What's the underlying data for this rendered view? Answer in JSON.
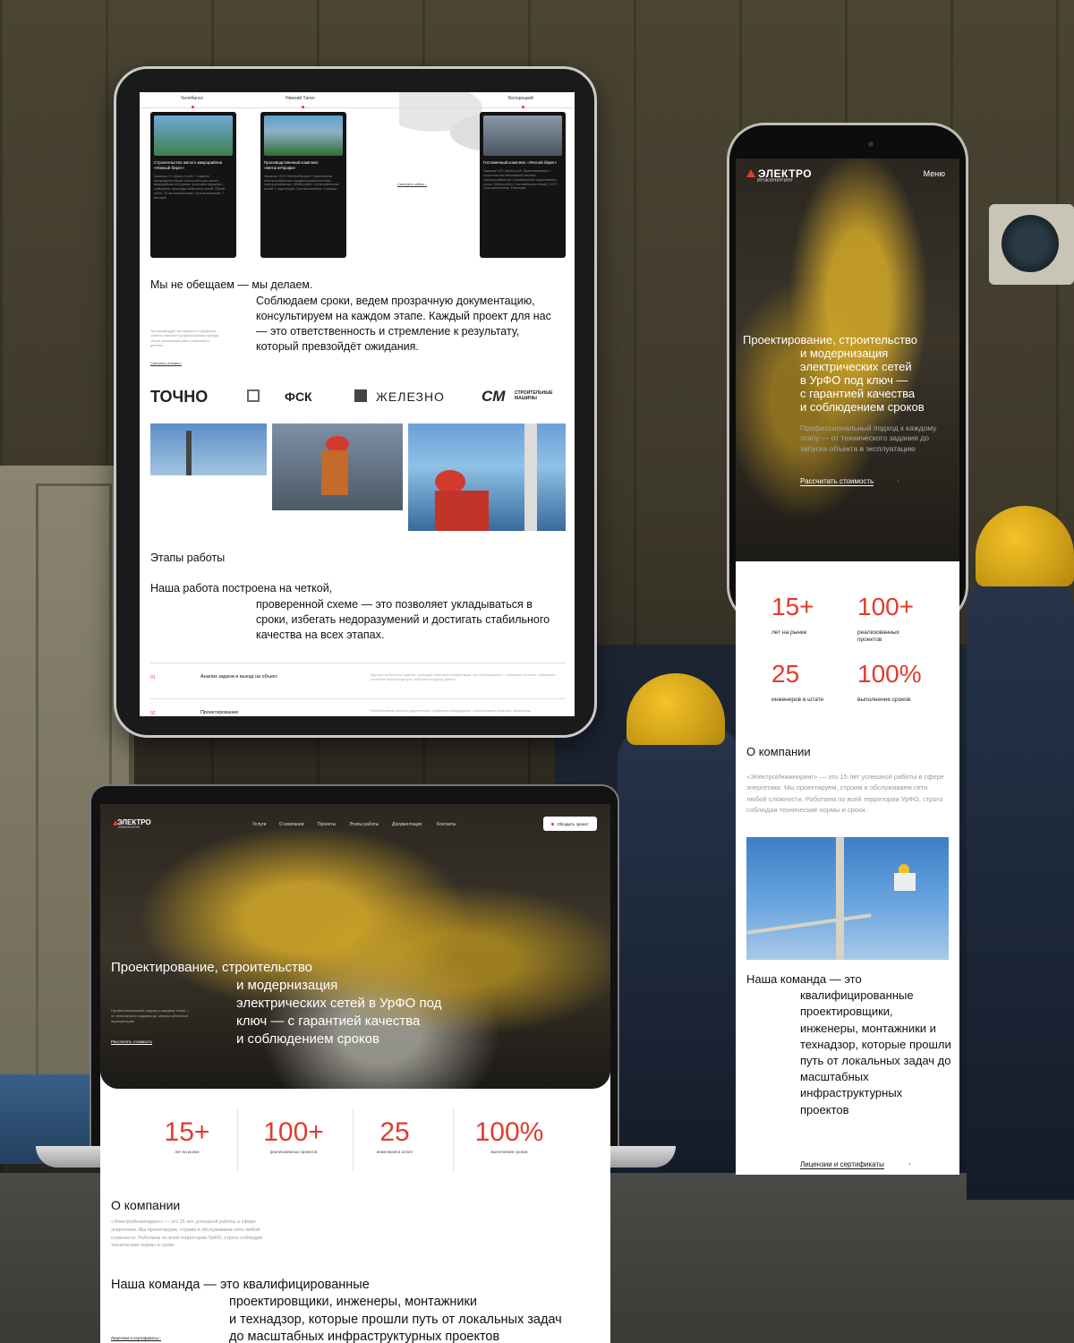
{
  "tablet": {
    "cities": [
      "Челябинск",
      "Нижний Тагил",
      "Белорецкий"
    ],
    "cards": [
      {
        "title": "Строительство жилого микрорайона «Южный берег»",
        "text": "Заказчик: ГК «Диал-Строй». Создание распределительной электросети для жилого микрорайона на 8 домов, установка наружного освещения, прокладка кабельных линий. Объём работ: 10 км электролиний. Срок выполнения: 7 месяцев"
      },
      {
        "title": "Производственный комплекс «МеталлПрофи»",
        "text": "Заказчик: ООО «МеталлПрофи». Комплексное электроснабжение с модернизацией системы электроснабжения. Объём работ: 4,8 км кабельных линий, 1 подстанция. Срок выполнения: 4 месяца"
      },
      {
        "title": "Гостиничный комплекс «Лесной берег»",
        "text": "Заказчик: ИП Сазонов А.В. Проектирование и строительство автономной системы электроснабжения с возможностью подключения к сетям. Объём работ: 3 км кабельных линий, 1 КТП. Срок выполнения: 5 месяцев"
      }
    ],
    "see_cases": "Смотреть кейсы ›",
    "tagline_head": "Мы не обещаем — мы делаем.",
    "tagline_body": "Соблюдаем сроки, ведем прозрачную документацию, консультируем на каждом этапе. Каждый проект для нас — это ответственность и стремление к результату, который превзойдёт ожидания.",
    "tagline_small": "Нас рекомендуют как надежного подрядчика: клиенты отмечают профессионализм команды, четкую организацию работ и внимание к деталям.",
    "reviews_link": "Смотреть отзывы ›",
    "logos": [
      "ТОЧНО",
      "ФСК",
      "ЖЕЛЕЗНО",
      "СМ",
      "СТРОИТЕЛЬНЫЕ МАШИНЫ"
    ],
    "steps_title": "Этапы работы",
    "steps_head": "Наша работа построена на четкой,",
    "steps_body": "проверенной схеме — это позволяет укладываться в сроки, избегать недоразумений и достигать стабильного качества на всех этапах.",
    "steps": [
      {
        "num": "01",
        "name": "Анализ задачи и выезд на объект",
        "desc": "Изучаем техническое задание, проводим первичную консультацию, при необходимости — выезжаем на место. Оцениваем состояние инфраструктуры, собираем исходные данные."
      },
      {
        "num": "02",
        "name": "Проектирование",
        "desc": "Разрабатываем рабочую документацию, подбираем оборудование, согласовываем решения с заказчиком."
      }
    ]
  },
  "phone": {
    "logo": "ЭЛЕКТРО",
    "logo_sub": "ИНЖИНИРИНГ",
    "menu": "Меню",
    "hero_first": "Проектирование, строительство",
    "hero_rest": [
      "и модернизация",
      "электрических сетей",
      "в УрФО под ключ —",
      "с гарантией качества",
      "и соблюдением сроков"
    ],
    "hero_sub": "Профессиональный подход к каждому этапу — от технического задания до запуска объекта в эксплуатацию",
    "cta": "Рассчитать стоимость",
    "stats": [
      {
        "num": "15+",
        "label": "лет на рынке"
      },
      {
        "num": "100+",
        "label": "реализованных проектов"
      },
      {
        "num": "25",
        "label": "инженеров в штате"
      },
      {
        "num": "100%",
        "label": "выполнение сроков"
      }
    ],
    "about_title": "О компании",
    "about_text": "«ЭлектроИнжиниринг» — это 15 лет успешной работы в сфере энергетики. Мы проектируем, строим и обслуживаем сети любой сложности. Работаем по всей территории УрФО, строго соблюдая технические нормы и сроки.",
    "team_first": "Наша команда — это",
    "team_rest": "квалифицированные проектировщики, инженеры, монтажники и технадзор, которые прошли путь от локальных задач до масштабных инфраструктурных проектов",
    "licenses": "Лицензии и сертификаты"
  },
  "laptop": {
    "logo": "ЭЛЕКТРО",
    "logo_sub": "ИНЖИНИРИНГ",
    "nav": [
      "Услуги",
      "О компании",
      "Проекты",
      "Этапы работы",
      "Документация",
      "Контакты"
    ],
    "cta_button": "Обсудить проект",
    "hero_first": "Проектирование, строительство",
    "hero_rest": [
      "и модернизация",
      "электрических сетей в УрФО под",
      "ключ — с гарантией качества",
      "и соблюдением сроков"
    ],
    "hero_small": "Профессиональный подход к каждому этапу — от технического задания до запуска объекта в эксплуатацию",
    "hero_cta": "Рассчитать стоимость",
    "stats": [
      {
        "num": "15+",
        "label": "лет на рынке"
      },
      {
        "num": "100+",
        "label": "реализованных проектов"
      },
      {
        "num": "25",
        "label": "инженеров в штате"
      },
      {
        "num": "100%",
        "label": "выполнение сроков"
      }
    ],
    "about_title": "О компании",
    "about_text": "«ЭлектроИнжиниринг» — это 15 лет успешной работы в сфере энергетики. Мы проектируем, строим и обслуживаем сети любой сложности. Работаем по всей территории УрФО, строго соблюдая технические нормы и сроки.",
    "team_first": "Наша команда — это квалифицированные",
    "team_rest": [
      "проектировщики, инженеры, монтажники",
      "и технадзор, которые прошли путь от локальных задач",
      "до масштабных инфраструктурных проектов"
    ],
    "licenses": "Лицензии и сертификаты ›"
  },
  "colors": {
    "accent": "#e23b2e",
    "dark": "#141414",
    "text": "#111111"
  }
}
